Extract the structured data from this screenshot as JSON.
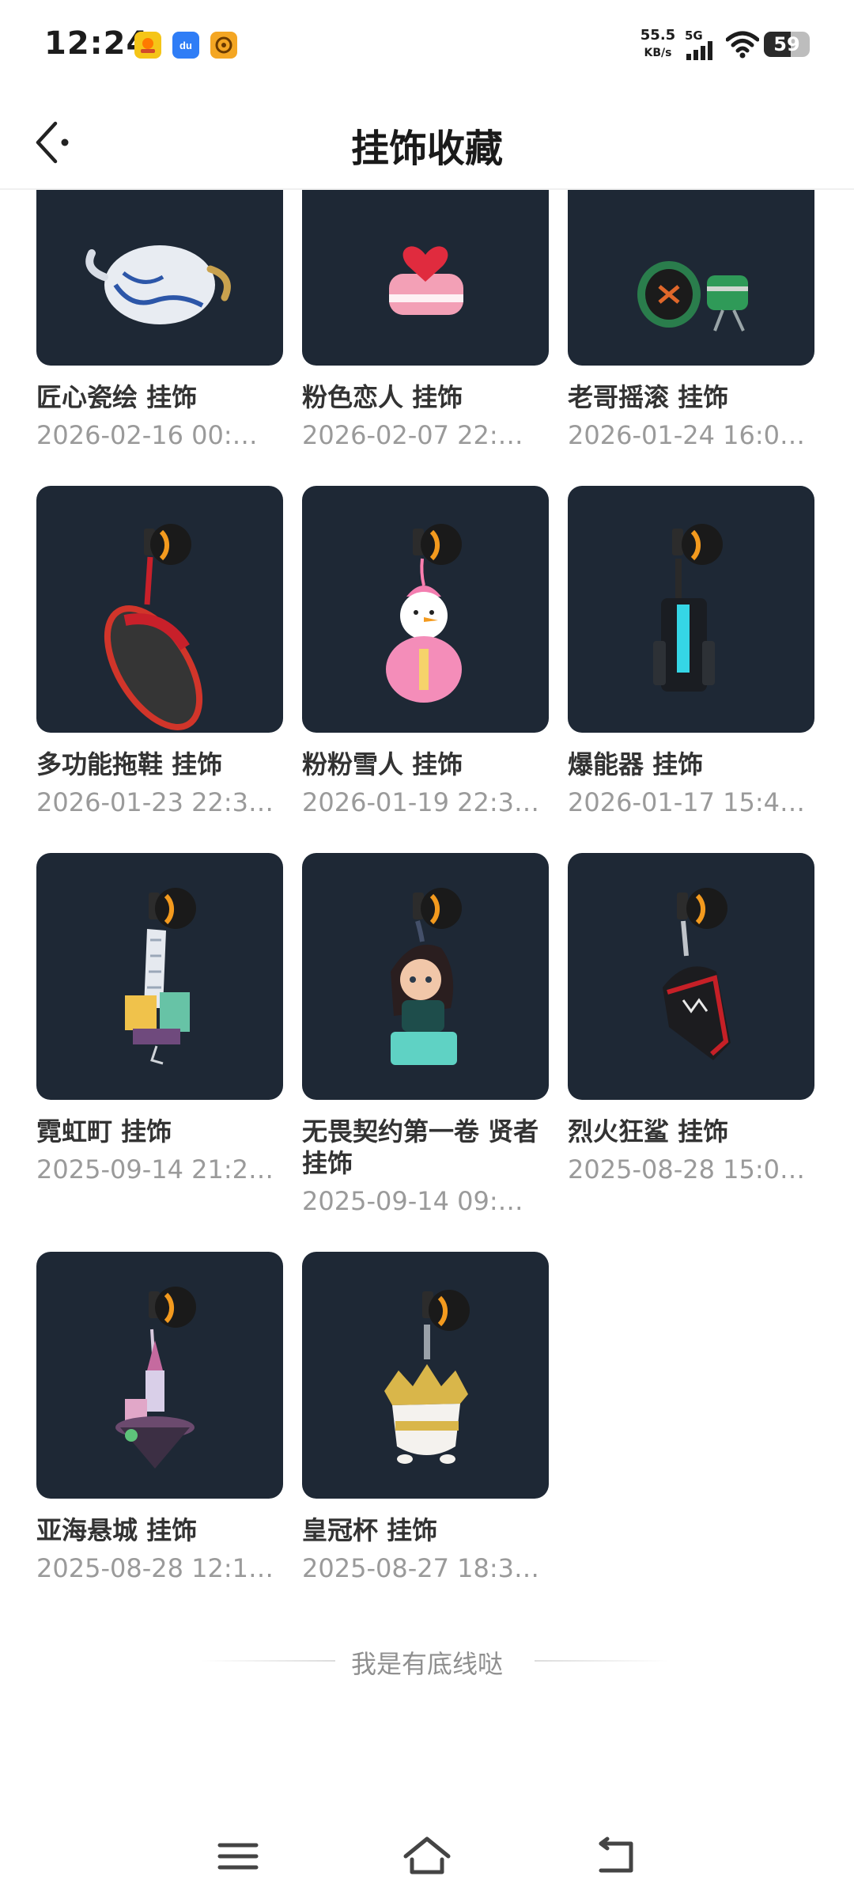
{
  "status_bar": {
    "time": "12:24",
    "net_speed": "55.5",
    "net_speed_unit": "KB/s",
    "network": "5G",
    "battery": "59",
    "notif_icons": [
      "app-yellow-icon",
      "app-du-icon",
      "app-target-icon"
    ]
  },
  "header": {
    "title": "挂饰收藏",
    "back_icon": "back-arrow-icon"
  },
  "items": [
    {
      "name": "匠心瓷绘 挂饰",
      "date": "2026-02-16 00:…",
      "icon": "teapot-charm"
    },
    {
      "name": "粉色恋人 挂饰",
      "date": "2026-02-07 22:…",
      "icon": "cake-charm"
    },
    {
      "name": "老哥摇滚 挂饰",
      "date": "2026-01-24 16:0…",
      "icon": "drums-charm"
    },
    {
      "name": "多功能拖鞋 挂饰",
      "date": "2026-01-23 22:3…",
      "icon": "slipper-charm"
    },
    {
      "name": "粉粉雪人 挂饰",
      "date": "2026-01-19 22:3…",
      "icon": "snowman-charm"
    },
    {
      "name": "爆能器 挂饰",
      "date": "2026-01-17 15:4…",
      "icon": "blaster-charm"
    },
    {
      "name": "霓虹町 挂饰",
      "date": "2025-09-14 21:2…",
      "icon": "city-charm"
    },
    {
      "name": "无畏契约第一卷 贤者 挂饰",
      "date": "2025-09-14 09:…",
      "icon": "sage-charm"
    },
    {
      "name": "烈火狂鲨 挂饰",
      "date": "2025-08-28 15:0…",
      "icon": "shark-charm"
    },
    {
      "name": "亚海悬城 挂饰",
      "date": "2025-08-28 12:1…",
      "icon": "floating-castle-charm"
    },
    {
      "name": "皇冠杯 挂饰",
      "date": "2025-08-27 18:3…",
      "icon": "crown-cup-charm"
    }
  ],
  "footer": {
    "end_text": "我是有底线哒"
  },
  "nav": {
    "menu_icon": "menu-icon",
    "home_icon": "home-icon",
    "back_icon": "back-icon"
  },
  "colors": {
    "card_bg": "#1e2835",
    "accent_orange": "#f39a1e",
    "text_primary": "#333333",
    "text_secondary": "#9a9a9a"
  }
}
